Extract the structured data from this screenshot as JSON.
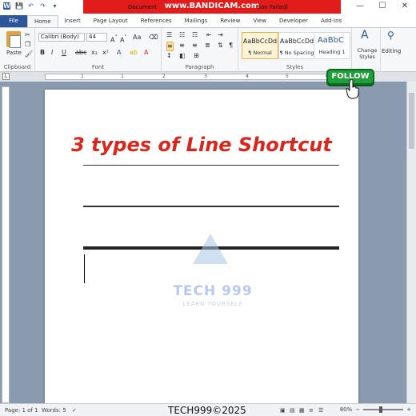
{
  "window": {
    "doc_title_left": "Document",
    "doc_title_right": "tion Failed)",
    "recorder_banner": "www.BANDICAM.com",
    "minimize": "—",
    "maximize": "☐",
    "close": "✕"
  },
  "qat": {
    "save": "💾",
    "undo": "↶",
    "redo": "↷",
    "customize": "▾"
  },
  "tabs": [
    "File",
    "Home",
    "Insert",
    "Page Layout",
    "References",
    "Mailings",
    "Review",
    "View",
    "Developer",
    "Add-Ins"
  ],
  "ribbon": {
    "clipboard": {
      "label": "Clipboard",
      "paste": "Paste"
    },
    "font": {
      "label": "Font",
      "family": "Calibri (Body)",
      "size": "44"
    },
    "paragraph": {
      "label": "Paragraph"
    },
    "styles": {
      "label": "Styles",
      "items": [
        {
          "sample": "AaBbCcDd",
          "name": "¶ Normal"
        },
        {
          "sample": "AaBbCcDd",
          "name": "¶ No Spacing"
        },
        {
          "sample": "AaBbC ",
          "name": "Heading 1"
        }
      ],
      "change_styles": "Change Styles"
    },
    "editing": {
      "label": "Editing"
    }
  },
  "ruler": {
    "tab_selector": "L",
    "numbers": [
      "1",
      "1",
      "2",
      "3",
      "4",
      "5",
      "6"
    ]
  },
  "document": {
    "heading": "3 types of Line Shortcut"
  },
  "watermark": {
    "title": "TECH 999",
    "subtitle": "LEARN YOURSELF"
  },
  "follow_button": "FOLLOW",
  "status": {
    "page": "Page: 1 of 1",
    "words": "Words: 5",
    "brand": "TECH999©2025",
    "zoom": "80%"
  },
  "colors": {
    "accent": "#2b579a",
    "heading": "#d8261c",
    "follow": "#1f9e3a",
    "banner": "#e21b1b"
  }
}
